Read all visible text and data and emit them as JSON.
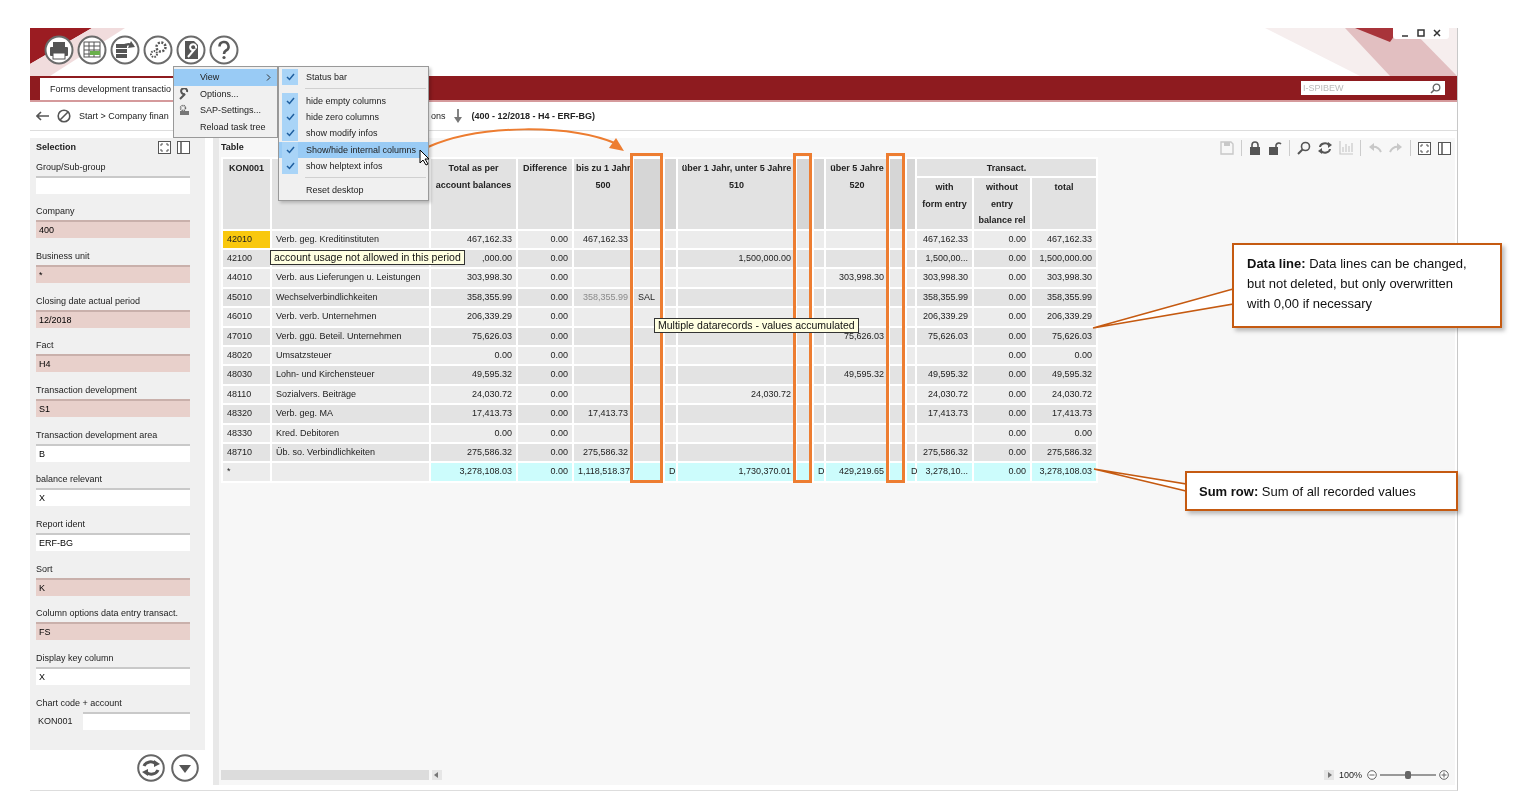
{
  "tabs": [
    {
      "label": "Forms development transactio",
      "selected": true
    }
  ],
  "search": {
    "placeholder": "I-SPIBEW"
  },
  "breadcrumb": {
    "parts": [
      "Start > Company finan",
      "ons"
    ],
    "context": "(400 - 12/2018 - H4 - ERF-BG)"
  },
  "menu": {
    "items": [
      {
        "label": "View",
        "selected": true,
        "has_submenu": true
      },
      {
        "label": "Options...",
        "selected": false,
        "has_submenu": false
      },
      {
        "label": "SAP-Settings...",
        "selected": false,
        "has_submenu": false
      },
      {
        "label": "Reload task tree",
        "selected": false,
        "has_submenu": false
      }
    ]
  },
  "submenu": {
    "sections": [
      [
        {
          "label": "Status bar",
          "checked": true,
          "selected": false
        }
      ],
      [
        {
          "label": "hide empty columns",
          "checked": true,
          "selected": false
        },
        {
          "label": "hide zero columns",
          "checked": true,
          "selected": false
        },
        {
          "label": "show modify infos",
          "checked": true,
          "selected": false
        },
        {
          "label": "Show/hide internal columns",
          "checked": true,
          "selected": true
        },
        {
          "label": "show helptext infos",
          "checked": true,
          "selected": false
        }
      ],
      [
        {
          "label": "Reset desktop",
          "checked": false,
          "selected": false
        }
      ]
    ]
  },
  "selection": {
    "title": "Selection",
    "fields": [
      {
        "label": "Group/Sub-group",
        "required": false
      },
      {
        "label": "Company",
        "value": "400",
        "required": true
      },
      {
        "label": "Business unit",
        "value": "*",
        "required": true
      },
      {
        "label": "Closing date actual period",
        "value": "12/2018",
        "required": true
      },
      {
        "label": "Fact",
        "value": "H4",
        "required": true
      },
      {
        "label": "Transaction development",
        "value": "S1",
        "required": true
      },
      {
        "label": "Transaction development area",
        "value": "B",
        "required": false
      },
      {
        "label": "balance relevant",
        "value": "X",
        "required": false
      },
      {
        "label": "Report ident",
        "value": "ERF-BG",
        "required": false
      },
      {
        "label": "Sort",
        "value": "K",
        "required": true
      },
      {
        "label": "Column options data entry transact.",
        "value": "FS",
        "required": true
      },
      {
        "label": "Display key column",
        "value": "X",
        "required": false
      },
      {
        "label": "Chart code + account",
        "prefix": "KON001",
        "required": false
      }
    ]
  },
  "table_panel": {
    "title": "Table"
  },
  "table": {
    "columns": [
      {
        "kind": "key",
        "lines": [
          "KON001"
        ]
      },
      {
        "kind": "text"
      },
      {
        "kind": "amount",
        "lines": [
          "Total as per",
          "account balances"
        ]
      },
      {
        "kind": "amount",
        "lines": [
          "Difference"
        ]
      },
      {
        "kind": "amount",
        "lines": [
          "bis zu 1 Jahr",
          "500"
        ]
      },
      {
        "kind": "internal"
      },
      {
        "kind": "internal"
      },
      {
        "kind": "amount",
        "lines": [
          "über 1 Jahr, unter 5 Jahre",
          "510"
        ]
      },
      {
        "kind": "internal"
      },
      {
        "kind": "internal"
      },
      {
        "kind": "amount",
        "lines": [
          "über 5 Jahre",
          "520"
        ]
      },
      {
        "kind": "internal"
      },
      {
        "kind": "internal"
      }
    ],
    "column_group": {
      "label": "Transact.",
      "columns": [
        {
          "kind": "amount",
          "lines": [
            "with",
            "form entry"
          ]
        },
        {
          "kind": "amount",
          "lines": [
            "without",
            "entry",
            "balance rel"
          ]
        },
        {
          "kind": "amount",
          "lines": [
            "total"
          ]
        }
      ]
    },
    "rows": [
      {
        "kind": "data",
        "selected": true,
        "cells": [
          "42010",
          "Verb. geg. Kreditinstituten",
          "467,162.33",
          "0.00",
          "467,162.33",
          null,
          null,
          null,
          null,
          null,
          null,
          null,
          null,
          "467,162.33",
          "0.00",
          "467,162.33"
        ]
      },
      {
        "kind": "data",
        "selected": false,
        "cells": [
          "42100",
          {
            "tooltip": "account usage not allowed in this period"
          },
          ",000.00",
          "0.00",
          null,
          null,
          null,
          "1,500,000.00",
          null,
          null,
          null,
          null,
          null,
          "1,500,00...",
          "0.00",
          "1,500,000.00"
        ]
      },
      {
        "kind": "data",
        "selected": false,
        "cells": [
          "44010",
          "Verb. aus Lieferungen u. Leistungen",
          "303,998.30",
          "0.00",
          null,
          null,
          null,
          null,
          null,
          null,
          "303,998.30",
          null,
          null,
          "303,998.30",
          "0.00",
          "303,998.30"
        ]
      },
      {
        "kind": "data",
        "selected": false,
        "cells": [
          "45010",
          "Wechselverbindlichkeiten",
          "358,355.99",
          "0.00",
          {
            "text": "358,355.99",
            "disabled": true
          },
          "SAL",
          null,
          null,
          null,
          null,
          null,
          null,
          null,
          "358,355.99",
          "0.00",
          "358,355.99"
        ]
      },
      {
        "kind": "data",
        "selected": false,
        "cells": [
          "46010",
          "Verb. verb. Unternehmen",
          "206,339.29",
          "0.00",
          null,
          {
            "tooltip": "Multiple datarecords - values accumulated"
          },
          null,
          null,
          null,
          null,
          null,
          null,
          null,
          "206,339.29",
          "0.00",
          "206,339.29"
        ]
      },
      {
        "kind": "data",
        "selected": false,
        "cells": [
          "47010",
          "Verb. ggü. Beteil. Unternehmen",
          "75,626.03",
          "0.00",
          null,
          null,
          null,
          null,
          null,
          null,
          "75,626.03",
          null,
          null,
          "75,626.03",
          "0.00",
          "75,626.03"
        ]
      },
      {
        "kind": "data",
        "selected": false,
        "cells": [
          "48020",
          "Umsatzsteuer",
          "0.00",
          "0.00",
          null,
          null,
          null,
          null,
          null,
          null,
          null,
          null,
          null,
          null,
          "0.00",
          "0.00"
        ]
      },
      {
        "kind": "data",
        "selected": false,
        "cells": [
          "48030",
          "Lohn- und Kirchensteuer",
          "49,595.32",
          "0.00",
          null,
          null,
          null,
          null,
          null,
          null,
          "49,595.32",
          null,
          null,
          "49,595.32",
          "0.00",
          "49,595.32"
        ]
      },
      {
        "kind": "data",
        "selected": false,
        "cells": [
          "48110",
          "Sozialvers. Beiträge",
          "24,030.72",
          "0.00",
          null,
          null,
          null,
          "24,030.72",
          null,
          null,
          null,
          null,
          null,
          "24,030.72",
          "0.00",
          "24,030.72"
        ]
      },
      {
        "kind": "data",
        "selected": false,
        "cells": [
          "48320",
          "Verb. geg. MA",
          "17,413.73",
          "0.00",
          "17,413.73",
          null,
          null,
          null,
          null,
          null,
          null,
          null,
          null,
          "17,413.73",
          "0.00",
          "17,413.73"
        ]
      },
      {
        "kind": "data",
        "selected": false,
        "cells": [
          "48330",
          "Kred. Debitoren",
          "0.00",
          "0.00",
          null,
          null,
          null,
          null,
          null,
          null,
          null,
          null,
          null,
          null,
          "0.00",
          "0.00"
        ]
      },
      {
        "kind": "data",
        "selected": false,
        "cells": [
          "48710",
          "Üb. so. Verbindlichkeiten",
          "275,586.32",
          "0.00",
          "275,586.32",
          null,
          null,
          null,
          null,
          null,
          null,
          null,
          null,
          "275,586.32",
          "0.00",
          "275,586.32"
        ]
      },
      {
        "kind": "sum",
        "selected": false,
        "cells": [
          "*",
          null,
          "3,278,108.03",
          "0.00",
          "1,118,518.37",
          null,
          "D",
          "1,730,370.01",
          null,
          "D",
          "429,219.65",
          null,
          "D",
          "3,278,10...",
          "0.00",
          "3,278,108.03"
        ]
      }
    ]
  },
  "zoom": {
    "reading": "100%",
    "level": 0.5
  },
  "callouts": [
    {
      "kind": "data_line",
      "text": "**Data line:** Data lines can be changed, but not deleted, but only overwritten with 0,00 if necessary"
    },
    {
      "kind": "sum_row",
      "text": "**Sum row:** Sum of all recorded values"
    }
  ]
}
